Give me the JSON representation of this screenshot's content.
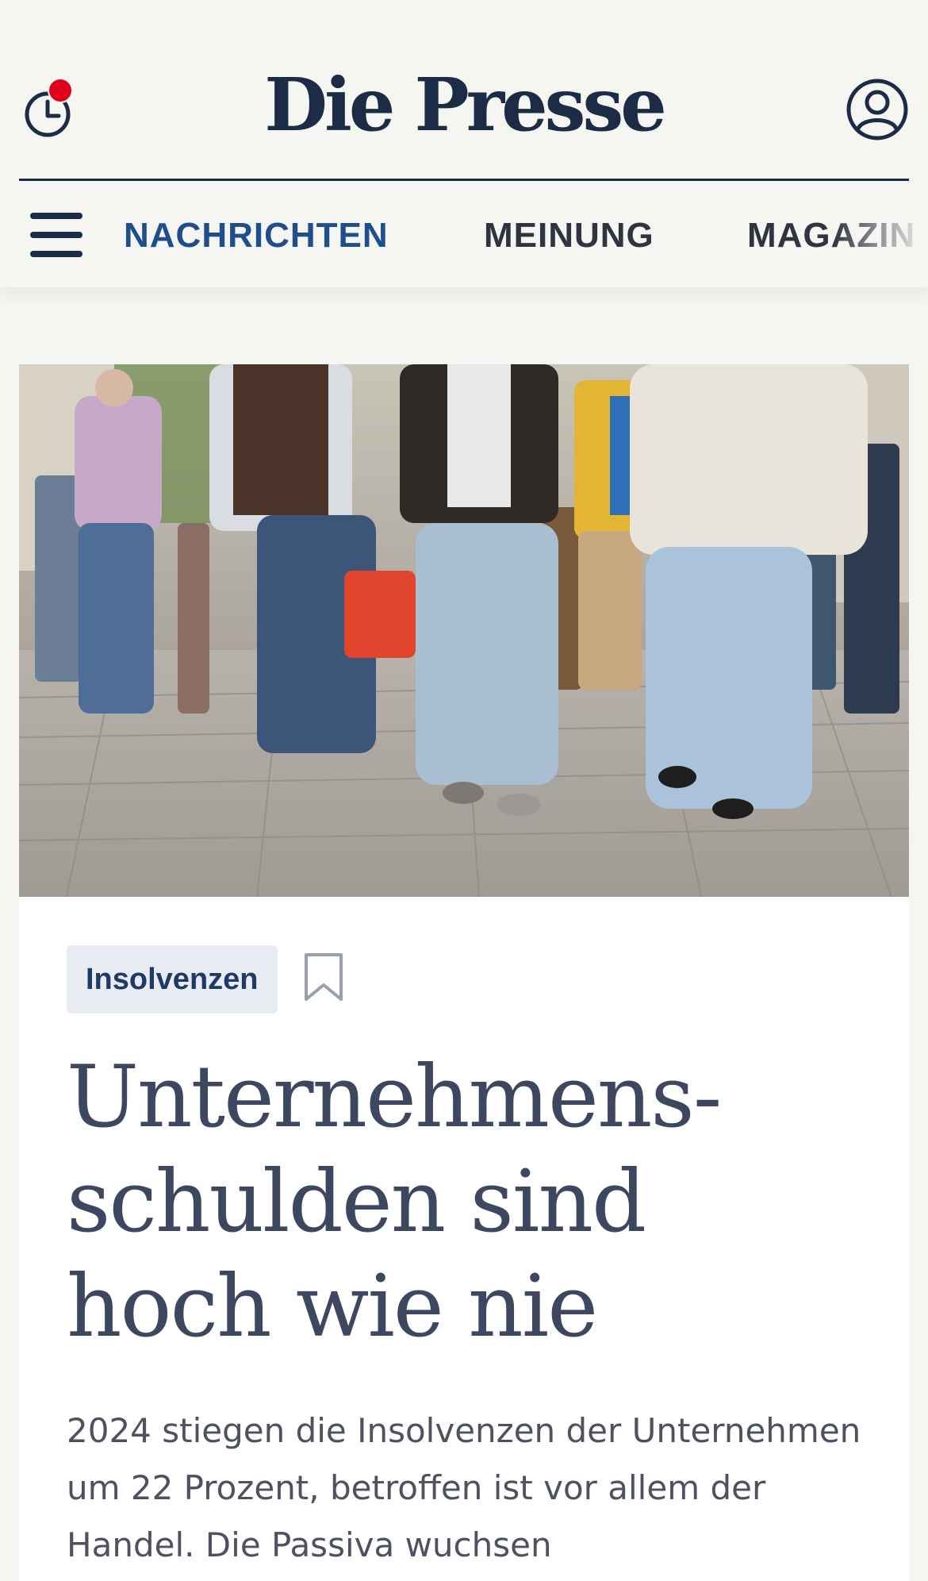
{
  "header": {
    "logo": "Die Presse",
    "history_icon": "clock-notification-icon",
    "account_icon": "user-circle-icon",
    "menu_icon": "hamburger-menu-icon",
    "nav": [
      {
        "label": "NACHRICHTEN",
        "active": true
      },
      {
        "label": "MEINUNG",
        "active": false
      },
      {
        "label": "MAGAZIN",
        "active": false
      }
    ]
  },
  "article": {
    "image_alt": "Passanten in einer Einkaufsstraße",
    "tag": "Insolvenzen",
    "bookmark_icon": "bookmark-icon",
    "headline_lines": [
      "Unternehmens-",
      "schulden sind",
      "hoch wie nie"
    ],
    "lead": "2024 stiegen die Insolvenzen der Unternehmen um 22 Prozent, betroffen ist vor allem der Handel. Die Passiva wuchsen"
  },
  "colors": {
    "brand": "#1c2b46",
    "nav_active": "#1f4e8c",
    "nav_inactive": "#2f3440",
    "notification": "#e0001b",
    "headline": "#3d4760",
    "tag_bg": "#e8ecf2",
    "background": "#f5f5f1"
  }
}
